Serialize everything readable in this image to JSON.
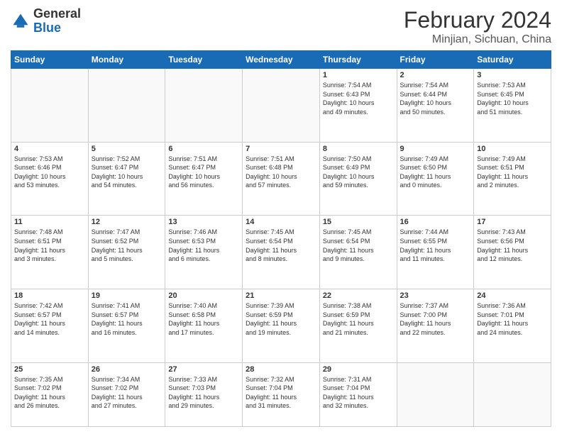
{
  "header": {
    "logo_general": "General",
    "logo_blue": "Blue",
    "title": "February 2024",
    "location": "Minjian, Sichuan, China"
  },
  "days_of_week": [
    "Sunday",
    "Monday",
    "Tuesday",
    "Wednesday",
    "Thursday",
    "Friday",
    "Saturday"
  ],
  "weeks": [
    [
      {
        "day": "",
        "info": ""
      },
      {
        "day": "",
        "info": ""
      },
      {
        "day": "",
        "info": ""
      },
      {
        "day": "",
        "info": ""
      },
      {
        "day": "1",
        "info": "Sunrise: 7:54 AM\nSunset: 6:43 PM\nDaylight: 10 hours\nand 49 minutes."
      },
      {
        "day": "2",
        "info": "Sunrise: 7:54 AM\nSunset: 6:44 PM\nDaylight: 10 hours\nand 50 minutes."
      },
      {
        "day": "3",
        "info": "Sunrise: 7:53 AM\nSunset: 6:45 PM\nDaylight: 10 hours\nand 51 minutes."
      }
    ],
    [
      {
        "day": "4",
        "info": "Sunrise: 7:53 AM\nSunset: 6:46 PM\nDaylight: 10 hours\nand 53 minutes."
      },
      {
        "day": "5",
        "info": "Sunrise: 7:52 AM\nSunset: 6:47 PM\nDaylight: 10 hours\nand 54 minutes."
      },
      {
        "day": "6",
        "info": "Sunrise: 7:51 AM\nSunset: 6:47 PM\nDaylight: 10 hours\nand 56 minutes."
      },
      {
        "day": "7",
        "info": "Sunrise: 7:51 AM\nSunset: 6:48 PM\nDaylight: 10 hours\nand 57 minutes."
      },
      {
        "day": "8",
        "info": "Sunrise: 7:50 AM\nSunset: 6:49 PM\nDaylight: 10 hours\nand 59 minutes."
      },
      {
        "day": "9",
        "info": "Sunrise: 7:49 AM\nSunset: 6:50 PM\nDaylight: 11 hours\nand 0 minutes."
      },
      {
        "day": "10",
        "info": "Sunrise: 7:49 AM\nSunset: 6:51 PM\nDaylight: 11 hours\nand 2 minutes."
      }
    ],
    [
      {
        "day": "11",
        "info": "Sunrise: 7:48 AM\nSunset: 6:51 PM\nDaylight: 11 hours\nand 3 minutes."
      },
      {
        "day": "12",
        "info": "Sunrise: 7:47 AM\nSunset: 6:52 PM\nDaylight: 11 hours\nand 5 minutes."
      },
      {
        "day": "13",
        "info": "Sunrise: 7:46 AM\nSunset: 6:53 PM\nDaylight: 11 hours\nand 6 minutes."
      },
      {
        "day": "14",
        "info": "Sunrise: 7:45 AM\nSunset: 6:54 PM\nDaylight: 11 hours\nand 8 minutes."
      },
      {
        "day": "15",
        "info": "Sunrise: 7:45 AM\nSunset: 6:54 PM\nDaylight: 11 hours\nand 9 minutes."
      },
      {
        "day": "16",
        "info": "Sunrise: 7:44 AM\nSunset: 6:55 PM\nDaylight: 11 hours\nand 11 minutes."
      },
      {
        "day": "17",
        "info": "Sunrise: 7:43 AM\nSunset: 6:56 PM\nDaylight: 11 hours\nand 12 minutes."
      }
    ],
    [
      {
        "day": "18",
        "info": "Sunrise: 7:42 AM\nSunset: 6:57 PM\nDaylight: 11 hours\nand 14 minutes."
      },
      {
        "day": "19",
        "info": "Sunrise: 7:41 AM\nSunset: 6:57 PM\nDaylight: 11 hours\nand 16 minutes."
      },
      {
        "day": "20",
        "info": "Sunrise: 7:40 AM\nSunset: 6:58 PM\nDaylight: 11 hours\nand 17 minutes."
      },
      {
        "day": "21",
        "info": "Sunrise: 7:39 AM\nSunset: 6:59 PM\nDaylight: 11 hours\nand 19 minutes."
      },
      {
        "day": "22",
        "info": "Sunrise: 7:38 AM\nSunset: 6:59 PM\nDaylight: 11 hours\nand 21 minutes."
      },
      {
        "day": "23",
        "info": "Sunrise: 7:37 AM\nSunset: 7:00 PM\nDaylight: 11 hours\nand 22 minutes."
      },
      {
        "day": "24",
        "info": "Sunrise: 7:36 AM\nSunset: 7:01 PM\nDaylight: 11 hours\nand 24 minutes."
      }
    ],
    [
      {
        "day": "25",
        "info": "Sunrise: 7:35 AM\nSunset: 7:02 PM\nDaylight: 11 hours\nand 26 minutes."
      },
      {
        "day": "26",
        "info": "Sunrise: 7:34 AM\nSunset: 7:02 PM\nDaylight: 11 hours\nand 27 minutes."
      },
      {
        "day": "27",
        "info": "Sunrise: 7:33 AM\nSunset: 7:03 PM\nDaylight: 11 hours\nand 29 minutes."
      },
      {
        "day": "28",
        "info": "Sunrise: 7:32 AM\nSunset: 7:04 PM\nDaylight: 11 hours\nand 31 minutes."
      },
      {
        "day": "29",
        "info": "Sunrise: 7:31 AM\nSunset: 7:04 PM\nDaylight: 11 hours\nand 32 minutes."
      },
      {
        "day": "",
        "info": ""
      },
      {
        "day": "",
        "info": ""
      }
    ]
  ]
}
